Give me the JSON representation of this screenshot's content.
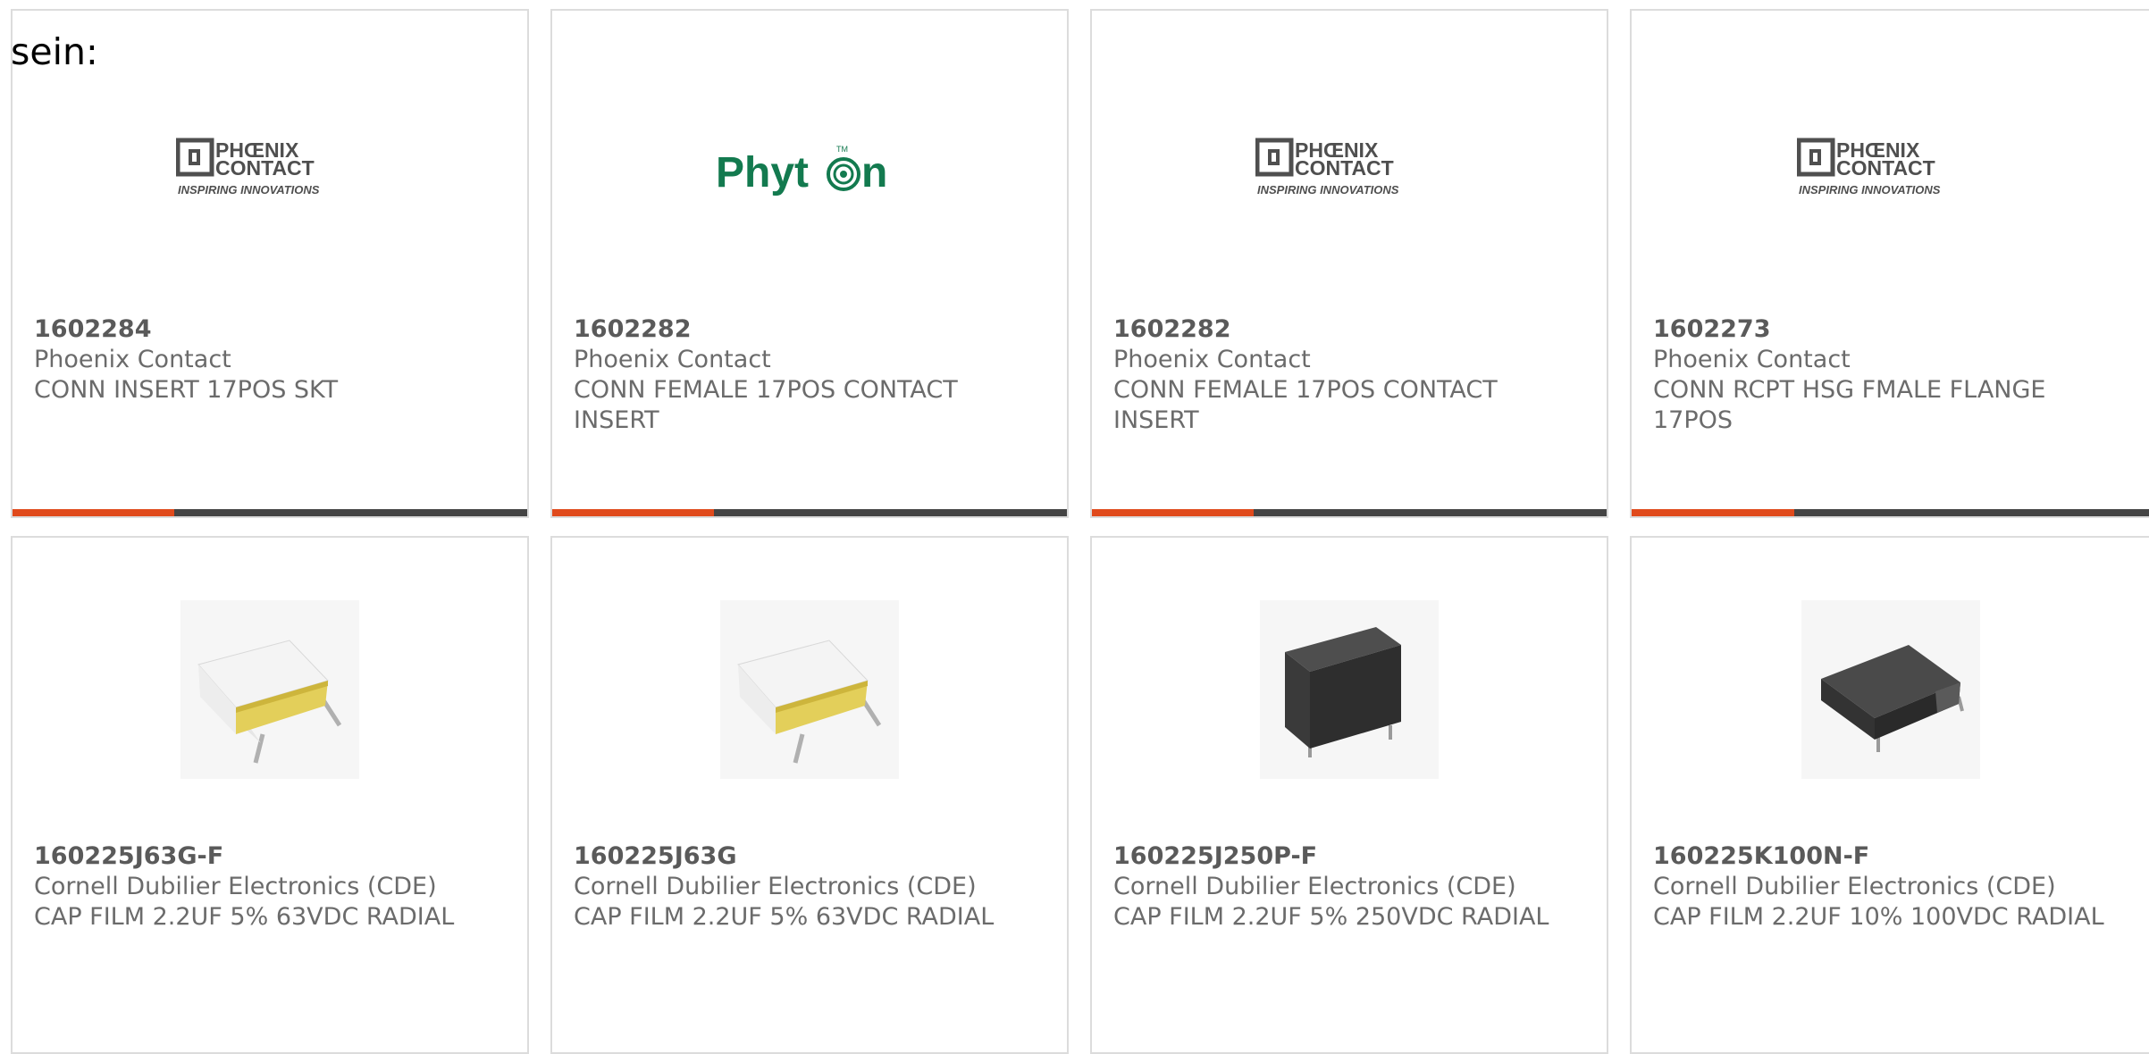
{
  "intro_text": "sein:",
  "colors": {
    "accent_orange": "#e04a1c",
    "accent_gray": "#444444",
    "phyton_green": "#137a4f"
  },
  "rows": [
    {
      "kind": "logo",
      "cards": [
        {
          "part": "1602284",
          "manufacturer": "Phoenix Contact",
          "description": "CONN INSERT 17POS SKT",
          "logo": {
            "type": "phoenix",
            "line1": "PHŒNIX",
            "line2": "CONTACT",
            "tagline": "INSPIRING INNOVATIONS"
          }
        },
        {
          "part": "1602282",
          "manufacturer": "Phoenix Contact",
          "description": "CONN FEMALE 17POS CONTACT INSERT",
          "logo": {
            "type": "phyton",
            "text": "Phyt",
            "text2": "n",
            "tm": "TM"
          }
        },
        {
          "part": "1602282",
          "manufacturer": "Phoenix Contact",
          "description": "CONN FEMALE 17POS CONTACT INSERT",
          "logo": {
            "type": "phoenix",
            "line1": "PHŒNIX",
            "line2": "CONTACT",
            "tagline": "INSPIRING INNOVATIONS"
          }
        },
        {
          "part": "1602273",
          "manufacturer": "Phoenix Contact",
          "description": "CONN RCPT HSG FMALE FLANGE 17POS",
          "logo": {
            "type": "phoenix",
            "line1": "PHŒNIX",
            "line2": "CONTACT",
            "tagline": "INSPIRING INNOVATIONS"
          }
        }
      ]
    },
    {
      "kind": "product",
      "cards": [
        {
          "part": "160225J63G-F",
          "manufacturer": "Cornell Dubilier Electronics (CDE)",
          "description": "CAP FILM 2.2UF 5% 63VDC RADIAL",
          "image": "yellow-film-capacitor-icon"
        },
        {
          "part": "160225J63G",
          "manufacturer": "Cornell Dubilier Electronics (CDE)",
          "description": "CAP FILM 2.2UF 5% 63VDC RADIAL",
          "image": "yellow-film-capacitor-icon"
        },
        {
          "part": "160225J250P-F",
          "manufacturer": "Cornell Dubilier Electronics (CDE)",
          "description": "CAP FILM 2.2UF 5% 250VDC RADIAL",
          "image": "black-box-capacitor-icon"
        },
        {
          "part": "160225K100N-F",
          "manufacturer": "Cornell Dubilier Electronics (CDE)",
          "description": "CAP FILM 2.2UF 10% 100VDC RADIAL",
          "image": "black-flat-capacitor-icon"
        }
      ]
    }
  ]
}
